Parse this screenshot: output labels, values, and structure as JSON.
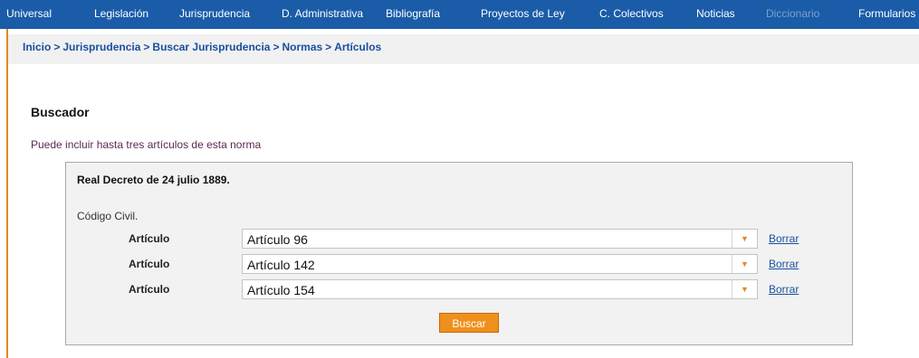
{
  "nav": {
    "items": [
      {
        "label": "Universal"
      },
      {
        "label": "Legislación"
      },
      {
        "label": "Jurisprudencia"
      },
      {
        "label": "D. Administrativa"
      },
      {
        "label": "Bibliografía"
      },
      {
        "label": "Proyectos de Ley"
      },
      {
        "label": "C. Colectivos"
      },
      {
        "label": "Noticias"
      },
      {
        "label": "Diccionario",
        "disabled": true
      },
      {
        "label": "Formularios"
      }
    ]
  },
  "breadcrumb": {
    "items": [
      "Inicio",
      "Jurisprudencia",
      "Buscar Jurisprudencia",
      "Normas",
      "Artículos"
    ],
    "separator": ">"
  },
  "buscador": {
    "title": "Buscador",
    "hint": "Puede incluir hasta tres artículos de esta norma",
    "norma": "Real Decreto de 24 julio 1889.",
    "codigo": "Código Civil.",
    "rows": [
      {
        "label": "Artículo",
        "value": "Artículo 96",
        "delete": "Borrar"
      },
      {
        "label": "Artículo",
        "value": "Artículo 142",
        "delete": "Borrar"
      },
      {
        "label": "Artículo",
        "value": "Artículo 154",
        "delete": "Borrar"
      }
    ],
    "search_label": "Buscar"
  },
  "colors": {
    "nav_bg": "#1a5ca8",
    "accent": "#f0901c",
    "link": "#1a4fa0"
  },
  "icons": {
    "dropdown": "chevron-down-icon"
  }
}
